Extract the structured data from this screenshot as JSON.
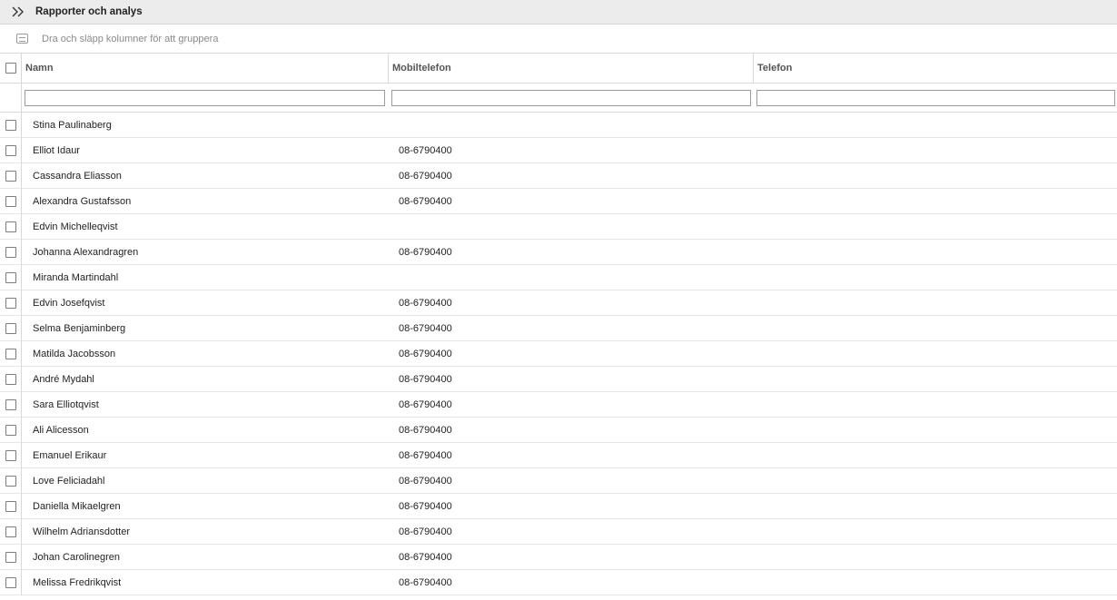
{
  "topbar": {
    "title": "Rapporter och analys",
    "expand_icon": "double-chevron-right-icon"
  },
  "groupbar": {
    "text": "Dra och släpp kolumner för att gruppera",
    "icon": "group-panel-icon"
  },
  "columns": {
    "name": "Namn",
    "mobile": "Mobiltelefon",
    "phone": "Telefon"
  },
  "filters": {
    "name": "",
    "mobile": "",
    "phone": ""
  },
  "rows": [
    {
      "name": "Stina Paulinaberg",
      "mobile": "",
      "phone": ""
    },
    {
      "name": "Elliot Idaur",
      "mobile": "08-6790400",
      "phone": ""
    },
    {
      "name": "Cassandra Eliasson",
      "mobile": "08-6790400",
      "phone": ""
    },
    {
      "name": "Alexandra Gustafsson",
      "mobile": "08-6790400",
      "phone": ""
    },
    {
      "name": "Edvin Michelleqvist",
      "mobile": "",
      "phone": ""
    },
    {
      "name": "Johanna Alexandragren",
      "mobile": "08-6790400",
      "phone": ""
    },
    {
      "name": "Miranda Martindahl",
      "mobile": "",
      "phone": ""
    },
    {
      "name": "Edvin Josefqvist",
      "mobile": "08-6790400",
      "phone": ""
    },
    {
      "name": "Selma Benjaminberg",
      "mobile": "08-6790400",
      "phone": ""
    },
    {
      "name": "Matilda Jacobsson",
      "mobile": "08-6790400",
      "phone": ""
    },
    {
      "name": "André Mydahl",
      "mobile": "08-6790400",
      "phone": ""
    },
    {
      "name": "Sara Elliotqvist",
      "mobile": "08-6790400",
      "phone": ""
    },
    {
      "name": "Ali Alicesson",
      "mobile": "08-6790400",
      "phone": ""
    },
    {
      "name": "Emanuel Erikaur",
      "mobile": "08-6790400",
      "phone": ""
    },
    {
      "name": "Love Feliciadahl",
      "mobile": "08-6790400",
      "phone": ""
    },
    {
      "name": "Daniella Mikaelgren",
      "mobile": "08-6790400",
      "phone": ""
    },
    {
      "name": "Wilhelm Adriansdotter",
      "mobile": "08-6790400",
      "phone": ""
    },
    {
      "name": "Johan Carolinegren",
      "mobile": "08-6790400",
      "phone": ""
    },
    {
      "name": "Melissa Fredrikqvist",
      "mobile": "08-6790400",
      "phone": ""
    }
  ]
}
